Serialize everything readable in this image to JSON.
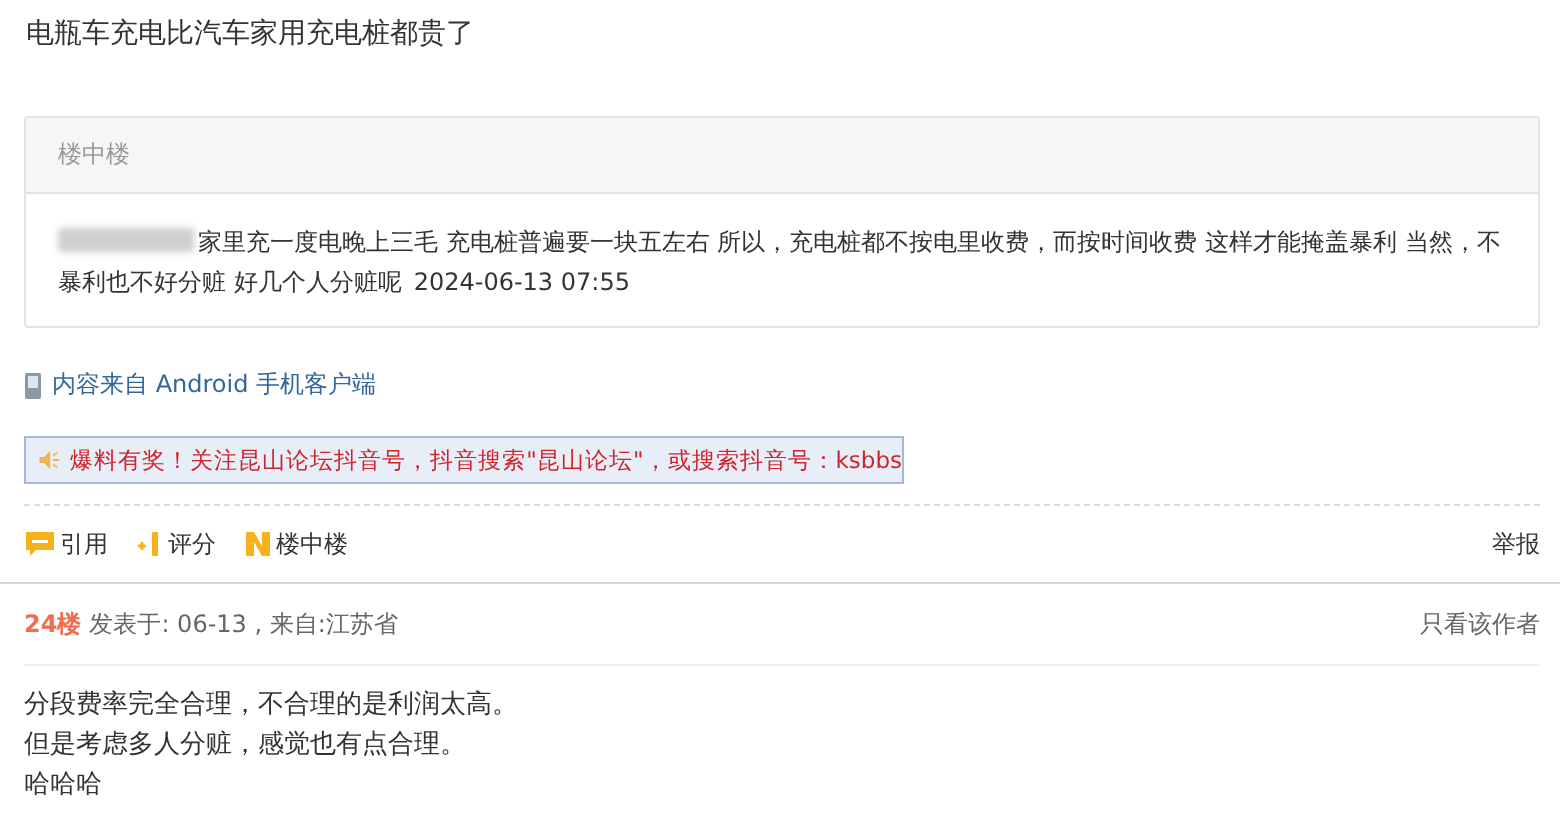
{
  "title": "电瓶车充电比汽车家用充电桩都贵了",
  "subreply_box": {
    "header": "楼中楼",
    "reply": {
      "text": "家里充一度电晚上三毛 充电桩普遍要一块五左右 所以，充电桩都不按电里收费，而按时间收费 这样才能掩盖暴利 当然，不暴利也不好分赃 好几个人分赃呢",
      "time": "2024-06-13 07:55"
    }
  },
  "client_note": "内容来自 Android 手机客户端",
  "notice": "爆料有奖！关注昆山论坛抖音号，抖音搜索\"昆山论坛\"，或搜索抖音号：ksbbs",
  "actions": [
    {
      "kind": "quote",
      "label": "引用"
    },
    {
      "kind": "rate",
      "label": "评分"
    },
    {
      "kind": "subreply",
      "label": "楼中楼"
    }
  ],
  "report": "举报",
  "post": {
    "floor": "24楼",
    "meta": "发表于: 06-13 , 来自:江苏省",
    "author_only": "只看该作者",
    "lines": [
      "分段费率完全合理，不合理的是利润太高。",
      "但是考虑多人分赃，感觉也有点合理。",
      "哈哈哈"
    ]
  }
}
